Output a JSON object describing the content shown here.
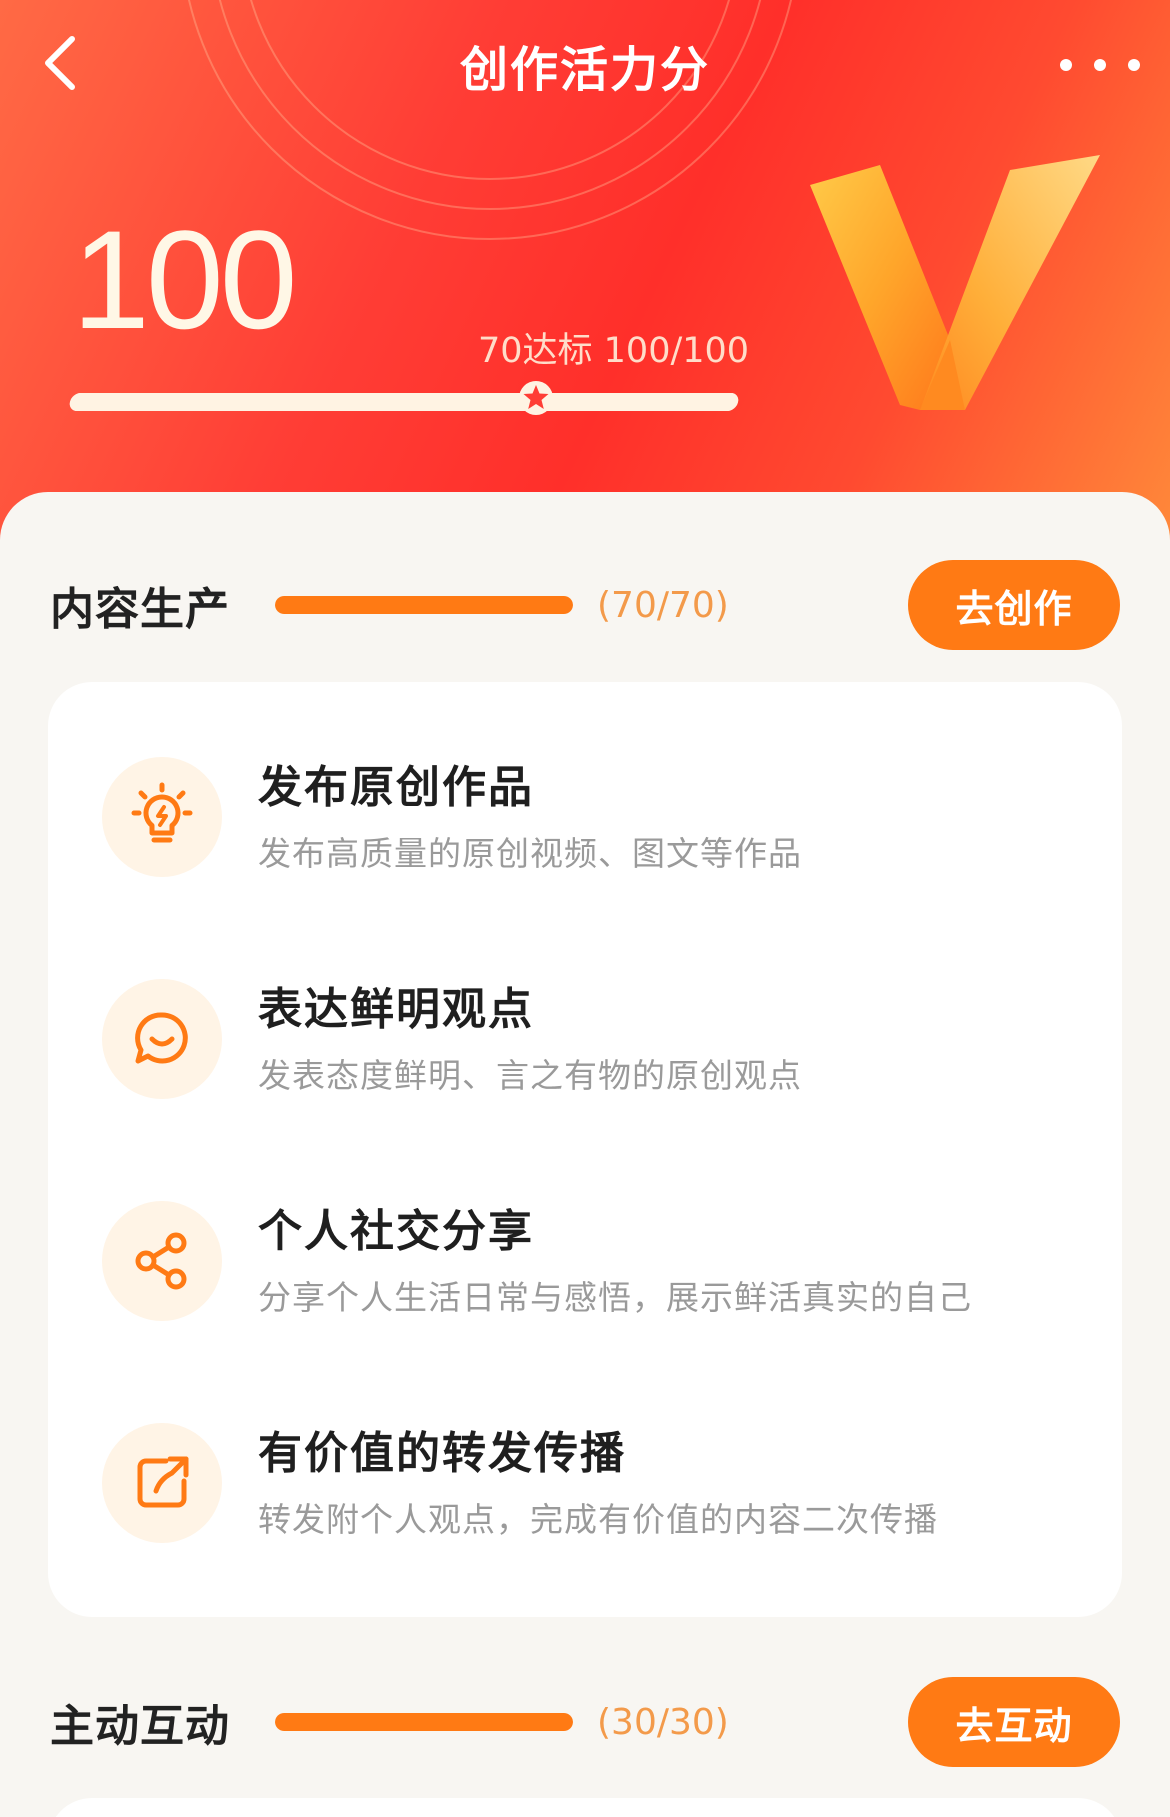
{
  "header": {
    "title": "创作活力分",
    "back_icon": "chevron-left-icon",
    "more_icon": "more-horizontal-icon"
  },
  "score": {
    "value": "100",
    "target_text": "70达标 100/100",
    "progress": 1.0,
    "threshold_fraction": 0.7
  },
  "sections": [
    {
      "title": "内容生产",
      "count": "(70/70)",
      "progress": 1.0,
      "button": "去创作",
      "tasks": [
        {
          "title": "发布原创作品",
          "desc": "发布高质量的原创视频、图文等作品",
          "icon": "lightbulb-icon"
        },
        {
          "title": "表达鲜明观点",
          "desc": "发表态度鲜明、言之有物的原创观点",
          "icon": "smile-chat-icon"
        },
        {
          "title": "个人社交分享",
          "desc": "分享个人生活日常与感悟，展示鲜活真实的自己",
          "icon": "share-icon"
        },
        {
          "title": "有价值的转发传播",
          "desc": "转发附个人观点，完成有价值的内容二次传播",
          "icon": "forward-icon"
        }
      ]
    },
    {
      "title": "主动互动",
      "count": "(30/30)",
      "progress": 1.0,
      "button": "去互动"
    }
  ],
  "colors": {
    "accent": "#ff7a14",
    "hero_red": "#ff2f2a",
    "track": "#f7e4d0"
  }
}
